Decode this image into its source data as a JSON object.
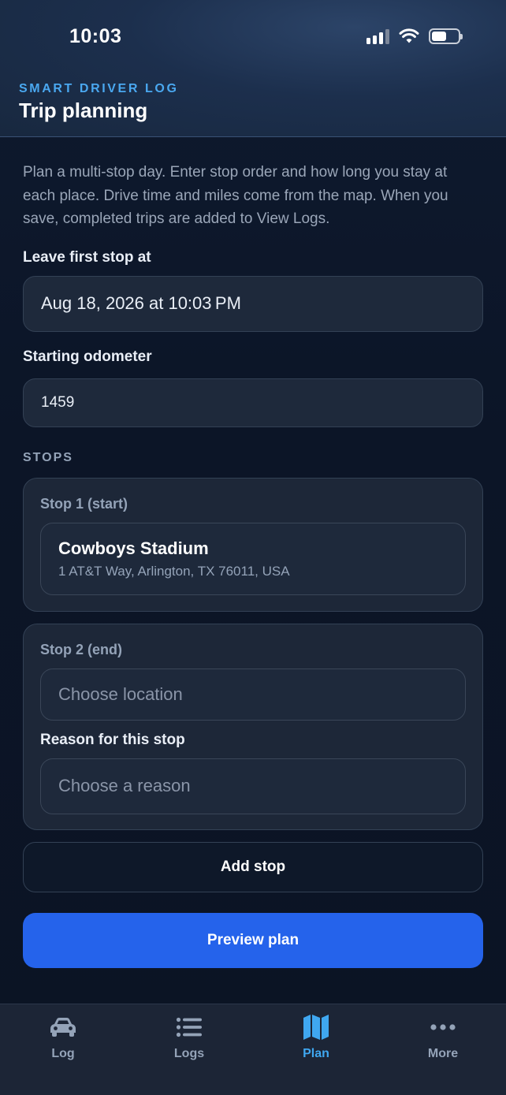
{
  "status_bar": {
    "time": "10:03"
  },
  "header": {
    "eyebrow": "SMART DRIVER LOG",
    "title": "Trip planning"
  },
  "intro": "Plan a multi-stop day. Enter stop order and how long you stay at each place. Drive time and miles come from the map. When you save, completed trips are added to View Logs.",
  "leave": {
    "label": "Leave first stop at",
    "value": "Aug 18, 2026 at 10:03 PM"
  },
  "odometer": {
    "label": "Starting odometer",
    "value": "1459"
  },
  "stops_section": "STOPS",
  "stops": [
    {
      "title": "Stop 1 (start)",
      "place_name": "Cowboys Stadium",
      "place_address": "1 AT&T Way, Arlington, TX 76011, USA"
    },
    {
      "title": "Stop 2 (end)",
      "location_placeholder": "Choose location",
      "reason_label": "Reason for this stop",
      "reason_placeholder": "Choose a reason"
    }
  ],
  "add_stop_label": "Add stop",
  "preview_label": "Preview plan",
  "tabs": [
    {
      "label": "Log",
      "icon": "car-icon",
      "active": false
    },
    {
      "label": "Logs",
      "icon": "list-icon",
      "active": false
    },
    {
      "label": "Plan",
      "icon": "map-icon",
      "active": true
    },
    {
      "label": "More",
      "icon": "more-icon",
      "active": false
    }
  ],
  "colors": {
    "accent": "#2563eb",
    "tab_active": "#3fa7f0",
    "eyebrow": "#4aa8f0",
    "background": "#0c1527"
  }
}
